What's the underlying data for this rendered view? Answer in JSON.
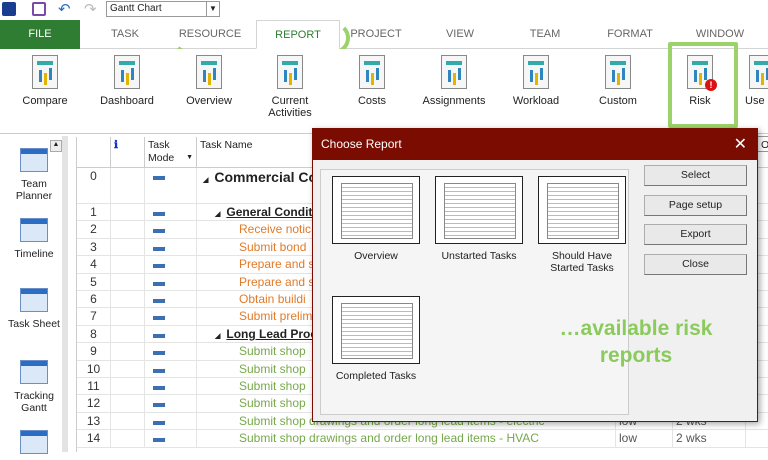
{
  "qat": {
    "view_selector": "Gantt Chart"
  },
  "tabs": [
    "FILE",
    "TASK",
    "RESOURCE",
    "REPORT",
    "PROJECT",
    "VIEW",
    "TEAM",
    "FORMAT",
    "WINDOW"
  ],
  "active_tab": "REPORT",
  "ribbon": [
    "Compare",
    "Dashboard",
    "Overview",
    "Current Activities",
    "Costs",
    "Assignments",
    "Workload",
    "Custom",
    "Risk",
    "Use"
  ],
  "sidebar": [
    "Team Planner",
    "Timeline",
    "Task Sheet",
    "Tracking Gantt"
  ],
  "grid": {
    "headers": {
      "info": "ℹ",
      "mode": "Task Mode",
      "name": "Task Name",
      "extra": "O"
    },
    "rows": [
      {
        "id": "0",
        "name": "Commercial Co",
        "type": "project"
      },
      {
        "id": "1",
        "name": "General Condit",
        "type": "summary"
      },
      {
        "id": "2",
        "name": "Receive notic",
        "type": "orange"
      },
      {
        "id": "3",
        "name": "Submit bond",
        "type": "orange"
      },
      {
        "id": "4",
        "name": "Prepare and s",
        "type": "orange"
      },
      {
        "id": "5",
        "name": "Prepare and s",
        "type": "orange"
      },
      {
        "id": "6",
        "name": "Obtain buildi",
        "type": "orange"
      },
      {
        "id": "7",
        "name": "Submit prelim",
        "type": "orange"
      },
      {
        "id": "8",
        "name": "Long Lead Procu",
        "type": "summary"
      },
      {
        "id": "9",
        "name": "Submit shop",
        "type": "green"
      },
      {
        "id": "10",
        "name": "Submit shop",
        "type": "green"
      },
      {
        "id": "11",
        "name": "Submit shop",
        "type": "green"
      },
      {
        "id": "12",
        "name": "Submit shop",
        "type": "green"
      },
      {
        "id": "13",
        "name": "Submit shop drawings and order long lead items - electric",
        "type": "green",
        "risk": "low",
        "dur": "2 wks"
      },
      {
        "id": "14",
        "name": "Submit shop drawings and order long lead items - HVAC",
        "type": "green",
        "risk": "low",
        "dur": "2 wks"
      }
    ]
  },
  "dialog": {
    "title": "Choose Report",
    "reports": [
      "Overview",
      "Unstarted Tasks",
      "Should Have Started Tasks",
      "Completed Tasks"
    ],
    "buttons": [
      "Select",
      "Page setup",
      "Export",
      "Close"
    ],
    "annotation": "…available risk reports"
  },
  "colors": {
    "file_tab": "#2e7d32",
    "dialog_title": "#7a0c02",
    "highlight": "#9bd36a"
  }
}
